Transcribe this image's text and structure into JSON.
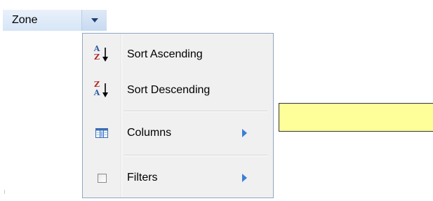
{
  "column_header": {
    "label": "Zone"
  },
  "menu": {
    "items": [
      {
        "label": "Sort Ascending",
        "icon": "sort-ascending-icon",
        "icon_letters": [
          "A",
          "Z"
        ]
      },
      {
        "label": "Sort Descending",
        "icon": "sort-descending-icon",
        "icon_letters": [
          "Z",
          "A"
        ]
      },
      {
        "label": "Columns",
        "icon": "columns-icon",
        "submenu": true
      },
      {
        "label": "Filters",
        "icon": "checkbox-icon",
        "submenu": true,
        "checked": false
      }
    ]
  },
  "colors": {
    "menu_border": "#8ea6c4",
    "menu_background": "#f0f0f0",
    "header_background": "#d6e5f6",
    "submenu_arrow": "#3a7fd5",
    "highlight_box": "#ffff99"
  }
}
